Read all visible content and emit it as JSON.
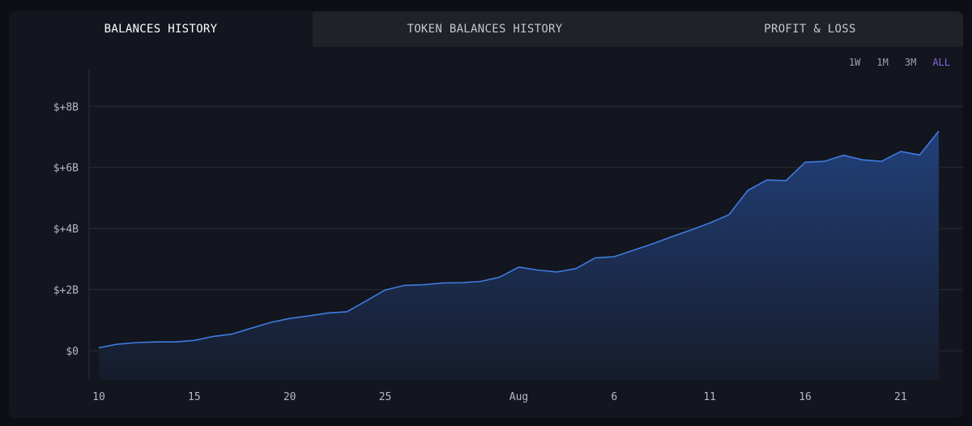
{
  "tabs": [
    {
      "label": "BALANCES HISTORY",
      "active": true
    },
    {
      "label": "TOKEN BALANCES HISTORY",
      "active": false
    },
    {
      "label": "PROFIT & LOSS",
      "active": false
    }
  ],
  "ranges": [
    {
      "label": "1W",
      "active": false
    },
    {
      "label": "1M",
      "active": false
    },
    {
      "label": "3M",
      "active": false
    },
    {
      "label": "ALL",
      "active": true
    }
  ],
  "colors": {
    "line": "#3f7be0",
    "fill_top": "#22407a",
    "fill_bottom": "#161c2b",
    "grid": "#2a2d35",
    "active_range": "#8a63e8"
  },
  "chart_data": {
    "type": "area",
    "y_unit": "billions USD",
    "ylim": [
      -0.95,
      9.2
    ],
    "y_ticks": [
      {
        "value": 0,
        "label": "$0"
      },
      {
        "value": 2,
        "label": "$+2B"
      },
      {
        "value": 4,
        "label": "$+4B"
      },
      {
        "value": 6,
        "label": "$+6B"
      },
      {
        "value": 8,
        "label": "$+8B"
      }
    ],
    "x_ticks": [
      {
        "day": 0,
        "label": "10"
      },
      {
        "day": 5,
        "label": "15"
      },
      {
        "day": 10,
        "label": "20"
      },
      {
        "day": 15,
        "label": "25"
      },
      {
        "day": 22,
        "label": "Aug"
      },
      {
        "day": 27,
        "label": "6"
      },
      {
        "day": 32,
        "label": "11"
      },
      {
        "day": 37,
        "label": "16"
      },
      {
        "day": 42,
        "label": "21"
      }
    ],
    "grid": true,
    "x_days": [
      0,
      1,
      2,
      3,
      4,
      5,
      6,
      7,
      8,
      9,
      10,
      11,
      12,
      13,
      14,
      15,
      16,
      17,
      18,
      19,
      20,
      21,
      22,
      23,
      24,
      25,
      26,
      27,
      28,
      29,
      30,
      31,
      32,
      33,
      34,
      35,
      36,
      37,
      38,
      39,
      40,
      41,
      42,
      43,
      44
    ],
    "values": [
      0.1,
      0.22,
      0.27,
      0.29,
      0.29,
      0.34,
      0.47,
      0.55,
      0.74,
      0.93,
      1.06,
      1.14,
      1.24,
      1.28,
      1.63,
      1.99,
      2.14,
      2.16,
      2.22,
      2.23,
      2.27,
      2.41,
      2.74,
      2.64,
      2.58,
      2.69,
      3.04,
      3.08,
      3.29,
      3.5,
      3.73,
      3.95,
      4.18,
      4.45,
      5.25,
      5.59,
      5.57,
      6.17,
      6.2,
      6.4,
      6.25,
      6.2,
      6.52,
      6.41,
      7.19
    ]
  }
}
